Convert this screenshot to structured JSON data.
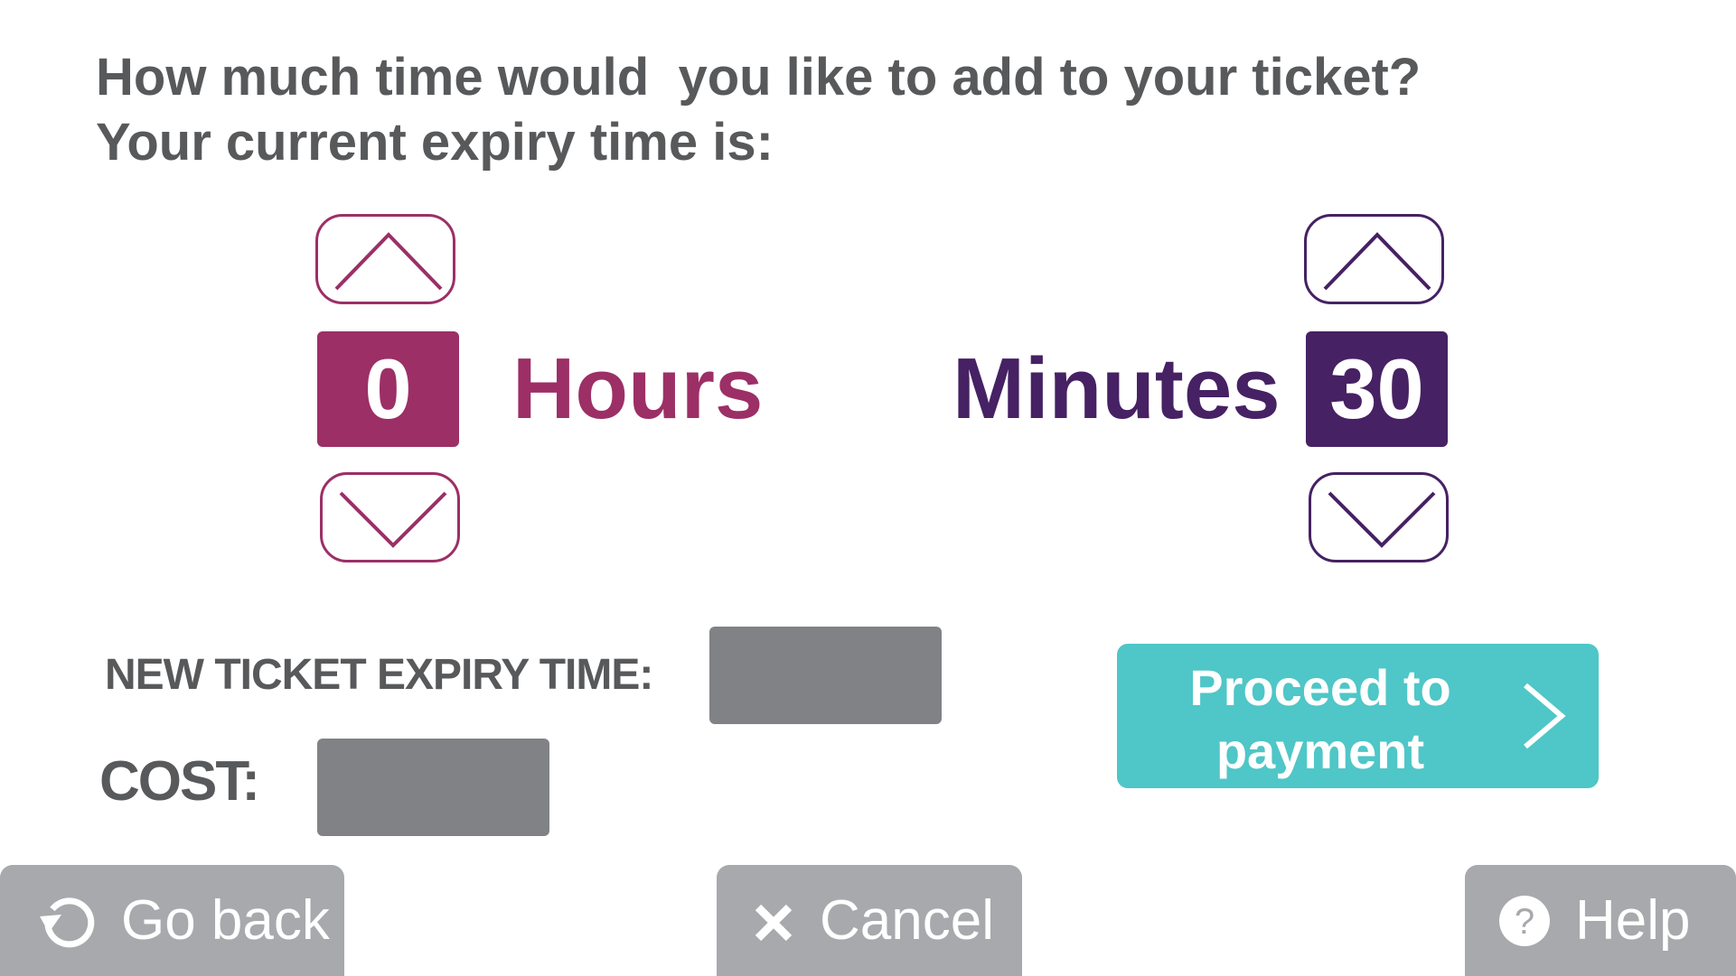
{
  "prompt": {
    "line1": "How much time would  you like to add to your ticket?",
    "line2": "Your current expiry time is:"
  },
  "hours": {
    "value": "0",
    "label": "Hours",
    "color": "#9c2f66",
    "up_icon": "chevron-up-icon",
    "down_icon": "chevron-down-icon"
  },
  "minutes": {
    "value": "30",
    "label": "Minutes",
    "color": "#462163",
    "up_icon": "chevron-up-icon",
    "down_icon": "chevron-down-icon"
  },
  "expiry": {
    "label": "NEW TICKET EXPIRY TIME:",
    "value": ""
  },
  "cost": {
    "label": "COST:",
    "value": ""
  },
  "proceed": {
    "line1": "Proceed to",
    "line2": "payment",
    "icon": "chevron-right-icon",
    "color": "#4fc6c7"
  },
  "footer": {
    "back_label": "Go back",
    "back_icon": "undo-arrow-icon",
    "cancel_label": "Cancel",
    "cancel_icon": "x-icon",
    "help_label": "Help",
    "help_icon": "question-circle-icon",
    "button_color": "#a7a9ac"
  },
  "colors": {
    "text": "#58595b",
    "field_grey": "#808285"
  }
}
